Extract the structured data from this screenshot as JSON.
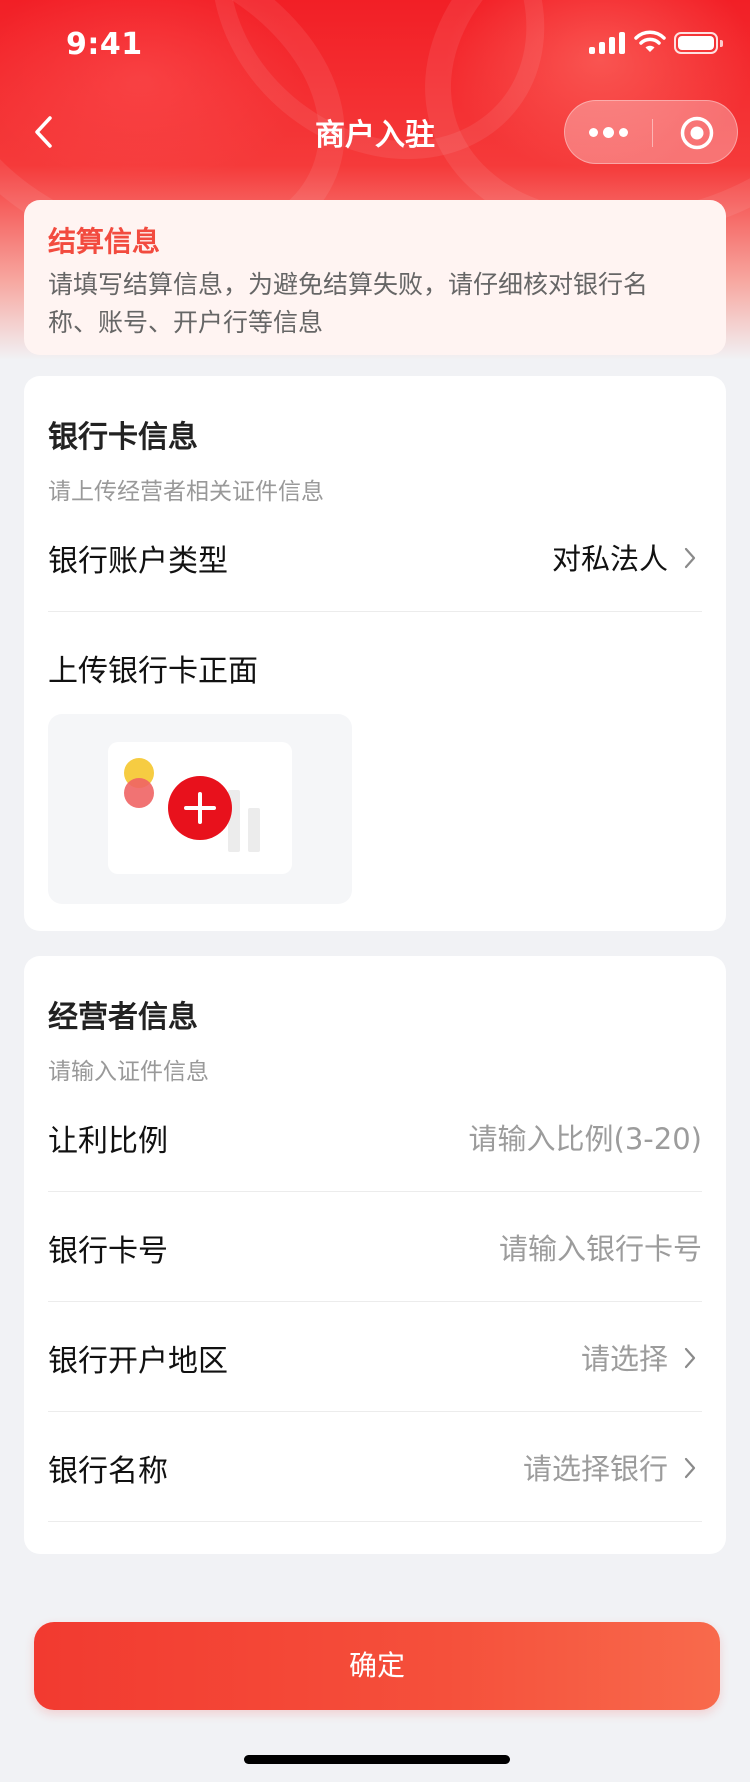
{
  "status_bar": {
    "time": "9:41"
  },
  "nav": {
    "title": "商户入驻"
  },
  "notice": {
    "title": "结算信息",
    "text": "请填写结算信息，为避免结算失败，请仔细核对银行名称、账号、开户行等信息"
  },
  "bank_card": {
    "title": "银行卡信息",
    "subtitle": "请上传经营者相关证件信息",
    "account_type": {
      "label": "银行账户类型",
      "value": "对私法人"
    },
    "upload": {
      "label": "上传银行卡正面"
    }
  },
  "operator": {
    "title": "经营者信息",
    "subtitle": "请输入证件信息",
    "rows": [
      {
        "label": "让利比例",
        "placeholder": "请输入比例(3-20)"
      },
      {
        "label": "银行卡号",
        "placeholder": "请输入银行卡号"
      },
      {
        "label": "银行开户地区",
        "placeholder": "请选择"
      },
      {
        "label": "银行名称",
        "placeholder": "请选择银行"
      }
    ]
  },
  "confirm_label": "确定",
  "colors": {
    "brand_red": "#e8111c",
    "notice_title": "#f24b3f",
    "notice_bg": "#fff4f2",
    "button_gradient_start": "#f23a30",
    "button_gradient_end": "#f86a4c"
  },
  "icons": {
    "back": "chevron-left-icon",
    "more": "more-dots-icon",
    "close": "target-ring-icon",
    "arrow": "chevron-right-icon",
    "upload": "plus-circle-icon"
  }
}
